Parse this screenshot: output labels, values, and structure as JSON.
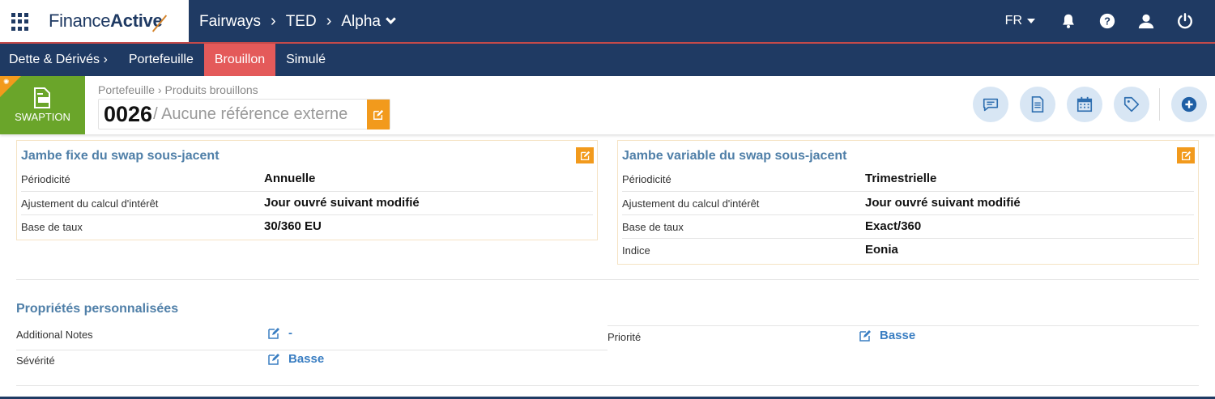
{
  "topbar": {
    "logo_regular": "Finance",
    "logo_bold": "Active",
    "breadcrumb": [
      "Fairways",
      "TED",
      "Alpha"
    ],
    "language": "FR",
    "icons": [
      "apps-icon",
      "bell-icon",
      "help-icon",
      "user-icon",
      "power-icon"
    ]
  },
  "subnav": {
    "items": [
      {
        "label": "Dette & Dérivés ›"
      },
      {
        "label": "Portefeuille"
      },
      {
        "label": "Brouillon",
        "active": true
      },
      {
        "label": "Simulé"
      }
    ],
    "active_color": "#e45a5a"
  },
  "header": {
    "product_type": "SWAPTION",
    "breadcrumb": "Portefeuille › Produits brouillons",
    "reference_number": "0026",
    "external_reference": "/ Aucune référence externe",
    "action_icons": [
      "comment-icon",
      "document-icon",
      "calendar-icon",
      "tag-icon",
      "add-icon"
    ]
  },
  "fixed_leg": {
    "title": "Jambe fixe du swap sous-jacent",
    "rows": [
      {
        "label": "Périodicité",
        "value": "Annuelle"
      },
      {
        "label": "Ajustement du calcul d'intérêt",
        "value": "Jour ouvré suivant modifié"
      },
      {
        "label": "Base de taux",
        "value": "30/360 EU"
      }
    ]
  },
  "variable_leg": {
    "title": "Jambe variable du swap sous-jacent",
    "rows": [
      {
        "label": "Périodicité",
        "value": "Trimestrielle"
      },
      {
        "label": "Ajustement du calcul d'intérêt",
        "value": "Jour ouvré suivant modifié"
      },
      {
        "label": "Base de taux",
        "value": "Exact/360"
      },
      {
        "label": "Indice",
        "value": "Eonia"
      }
    ]
  },
  "custom_properties": {
    "title": "Propriétés personnalisées",
    "additional_notes": {
      "label": "Additional Notes",
      "value": "-"
    },
    "severity": {
      "label": "Sévérité",
      "value": "Basse"
    },
    "priority": {
      "label": "Priorité",
      "value": "Basse"
    }
  },
  "colors": {
    "navy": "#1f3a63",
    "accent_orange": "#f29a1c",
    "badge_green": "#6aa52a",
    "title_blue": "#4f7fa8",
    "link_blue": "#3a7ec2"
  }
}
